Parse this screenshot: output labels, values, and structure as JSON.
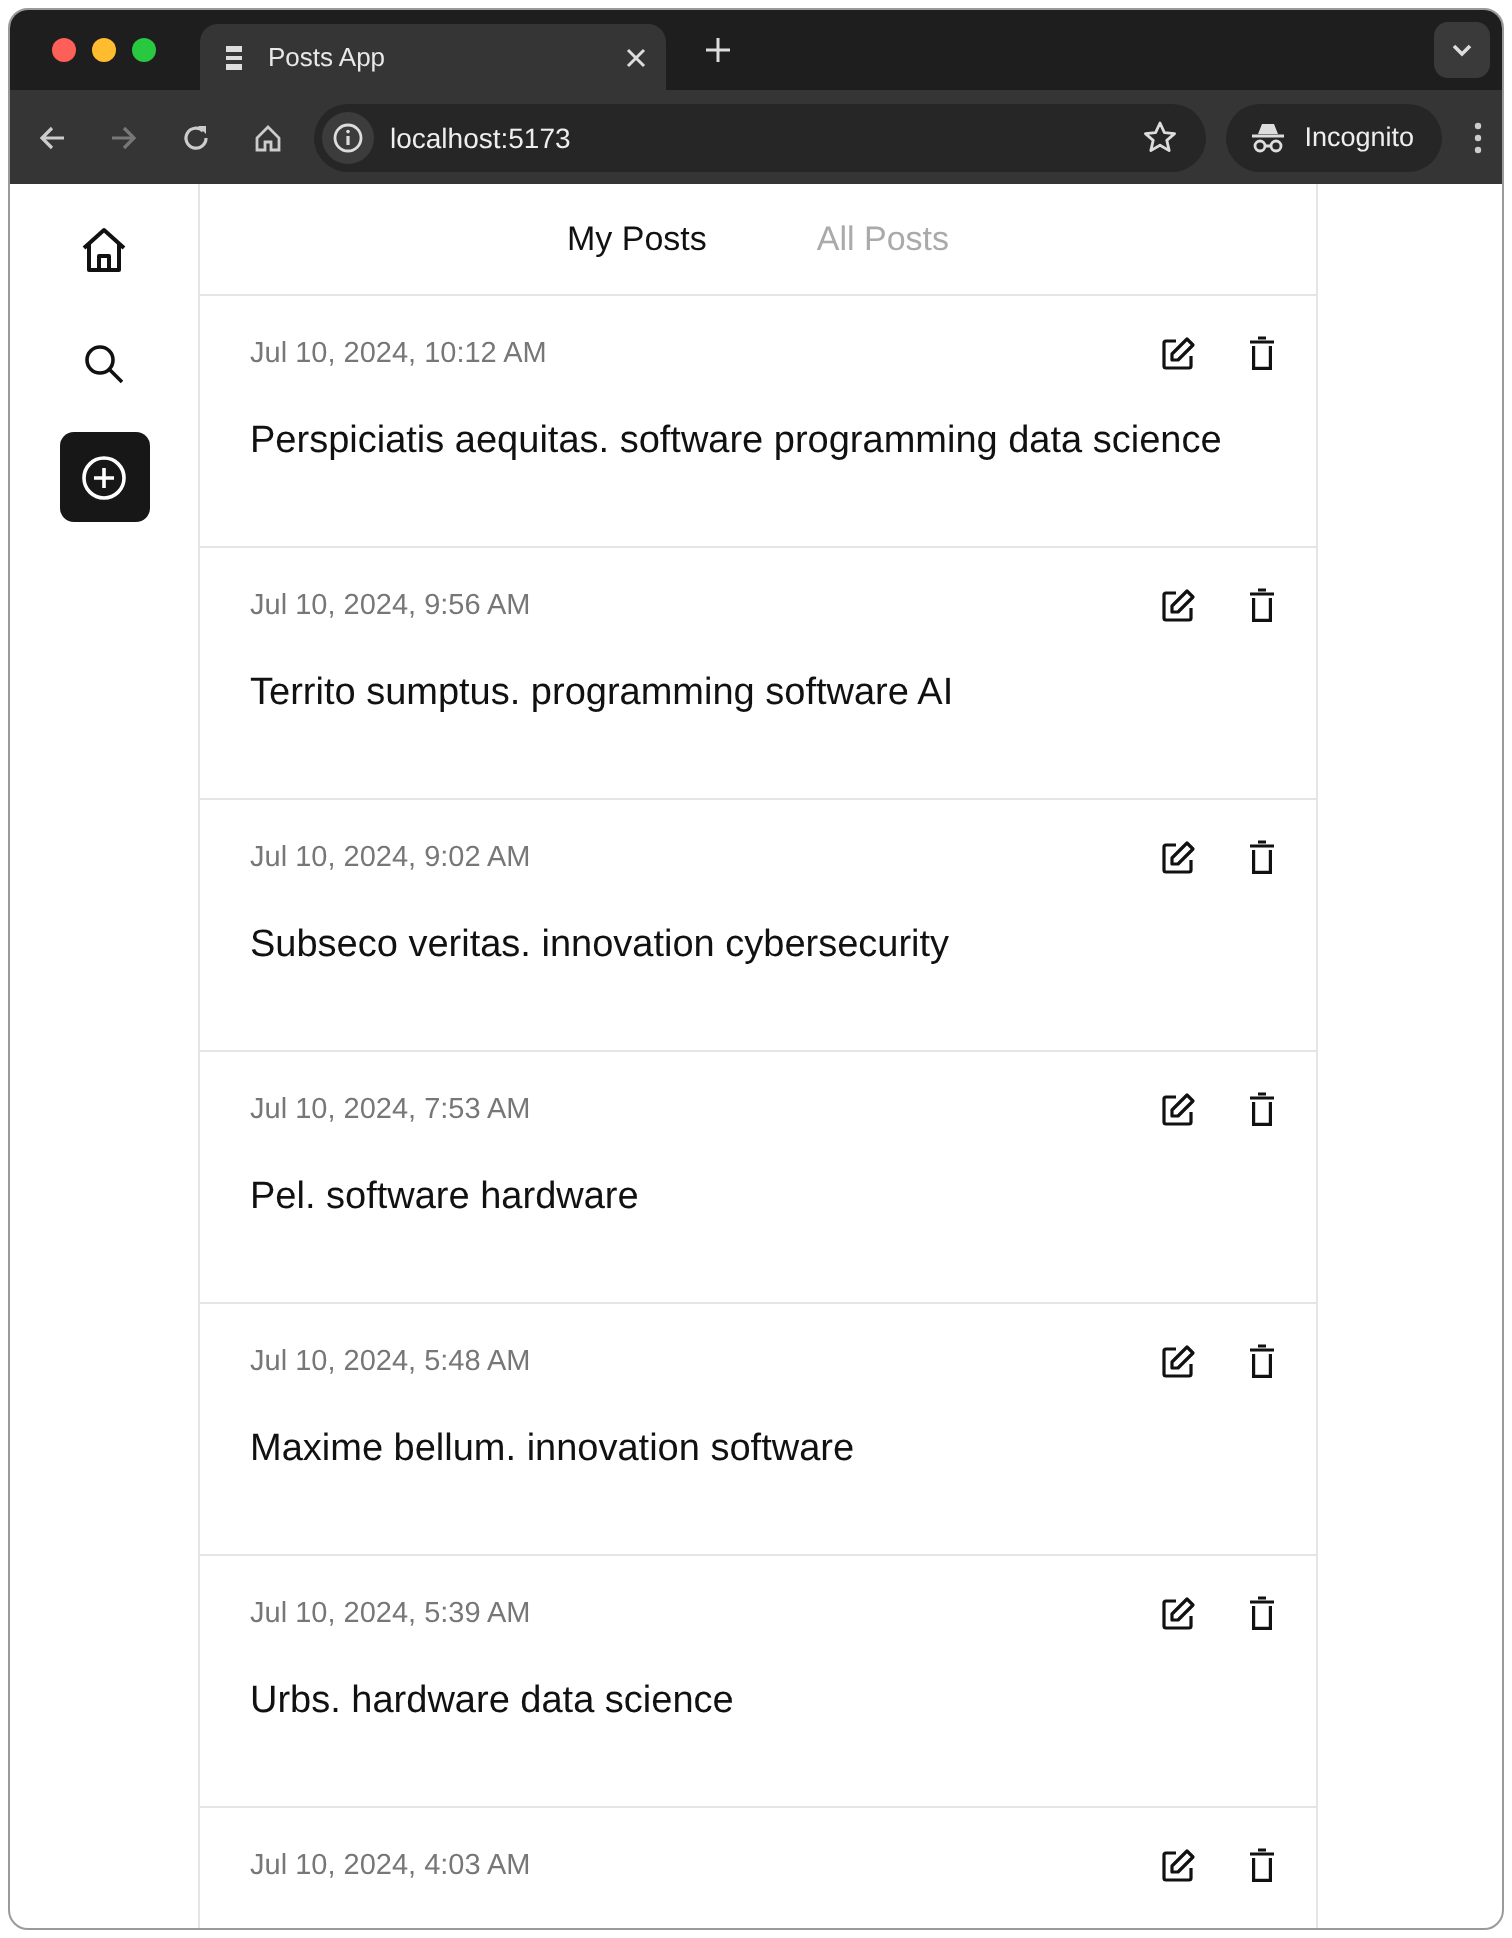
{
  "browser": {
    "tab_title": "Posts App",
    "url": "localhost:5173",
    "profile": "Incognito"
  },
  "sidebar": {
    "items": [
      {
        "kind": "home",
        "selected": false
      },
      {
        "kind": "search",
        "selected": false
      },
      {
        "kind": "create",
        "selected": true
      }
    ]
  },
  "tabs": [
    {
      "label": "My Posts",
      "selected": true
    },
    {
      "label": "All Posts",
      "selected": false
    }
  ],
  "posts": [
    {
      "date": "Jul 10, 2024, 10:12 AM",
      "body": "Perspiciatis aequitas. software programming data science"
    },
    {
      "date": "Jul 10, 2024, 9:56 AM",
      "body": "Territo sumptus. programming software AI"
    },
    {
      "date": "Jul 10, 2024, 9:02 AM",
      "body": "Subseco veritas. innovation cybersecurity"
    },
    {
      "date": "Jul 10, 2024, 7:53 AM",
      "body": "Pel. software hardware"
    },
    {
      "date": "Jul 10, 2024, 5:48 AM",
      "body": "Maxime bellum. innovation software"
    },
    {
      "date": "Jul 10, 2024, 5:39 AM",
      "body": "Urbs. hardware data science"
    },
    {
      "date": "Jul 10, 2024, 4:03 AM"
    }
  ]
}
